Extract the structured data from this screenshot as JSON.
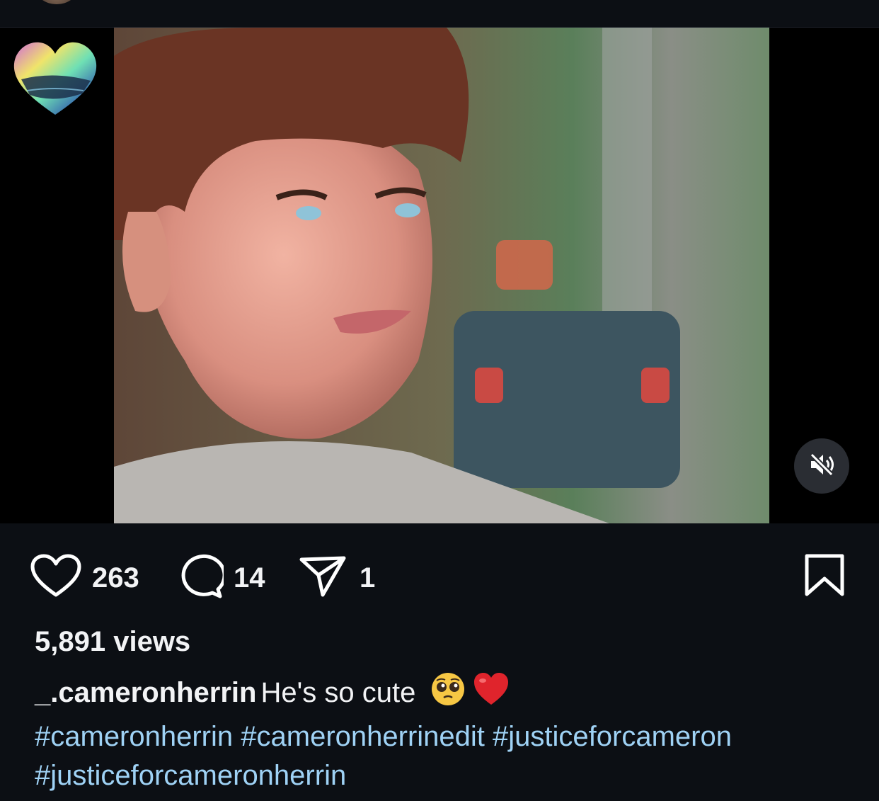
{
  "post": {
    "likes": "263",
    "comments": "14",
    "shares": "1",
    "views": "5,891 views",
    "username": "_.cameronherrin",
    "caption": "He's so cute",
    "caption_emojis": [
      "pleading-face",
      "red-heart"
    ],
    "hashtags": [
      "#cameronherrin",
      "#cameronherrinedit",
      "#justiceforcameron",
      "#justiceforcameronherrin"
    ]
  },
  "colors": {
    "background": "#0c0f14",
    "hashtag": "#9fd2f5",
    "text": "#f2f3f5"
  },
  "icons": [
    "heart-icon",
    "comment-icon",
    "share-icon",
    "bookmark-icon",
    "muted-speaker-icon"
  ]
}
